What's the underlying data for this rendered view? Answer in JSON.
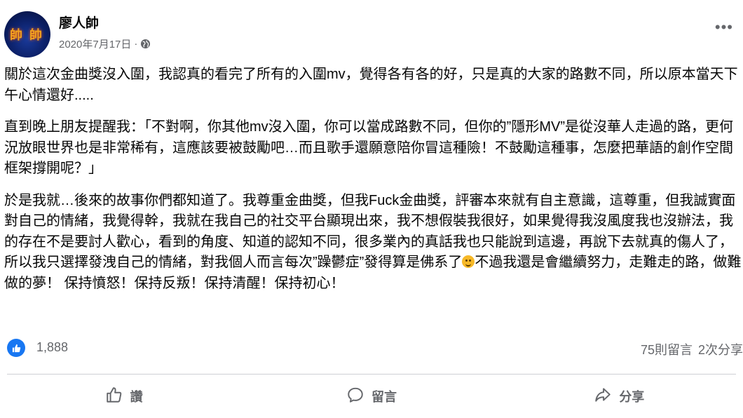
{
  "post": {
    "author": "廖人帥",
    "avatar_label": [
      "帥",
      "帥"
    ],
    "date": "2020年7月17日",
    "separator": "·",
    "paragraphs": [
      "關於這次金曲獎沒入圍，我認真的看完了所有的入圍mv，覺得各有各的好，只是真的大家的路數不同，所以原本當天下午心情還好.....",
      "直到晚上朋友提醒我：「不對啊，你其他mv沒入圍，你可以當成路數不同，但你的”隱形MV”是從沒華人走過的路，更何況放眼世界也是非常稀有，這應該要被鼓勵吧…而且歌手還願意陪你冒這種險！不鼓勵這種事，怎麼把華語的創作空間框架撐開呢？」"
    ],
    "paragraph3_part1": "於是我就…後來的故事你們都知道了。我尊重金曲獎，但我Fuck金曲獎，評審本來就有自主意識，這尊重，但我誠實面對自己的情緒，我覺得幹，我就在我自己的社交平台顯現出來，我不想假裝我很好，如果覺得我沒風度我也沒辦法，我的存在不是要討人歡心，看到的角度、知道的認知不同，很多業內的真話我也只能說到這邊，再說下去就真的傷人了，所以我只選擇發洩自己的情緒，對我個人而言每次”躁鬱症”發得算是佛系了",
    "paragraph3_part2": "不過我還是會繼續努力，走難走的路，做難做的夢！ 保持憤怒！保持反叛！保持清醒！保持初心！"
  },
  "stats": {
    "likes": "1,888",
    "comments": "75則留言",
    "shares": "2次分享"
  },
  "actions": {
    "like": "讚",
    "comment": "留言",
    "share": "分享"
  },
  "icons": {
    "more": "more-options-icon",
    "globe": "globe-icon",
    "like": "thumbs-up-icon",
    "comment": "comment-bubble-icon",
    "share": "share-arrow-icon",
    "emoji": "upside-down-face-emoji"
  },
  "colors": {
    "accent": "#1877f2",
    "secondary_text": "#65676b",
    "divider": "#ced0d4"
  }
}
